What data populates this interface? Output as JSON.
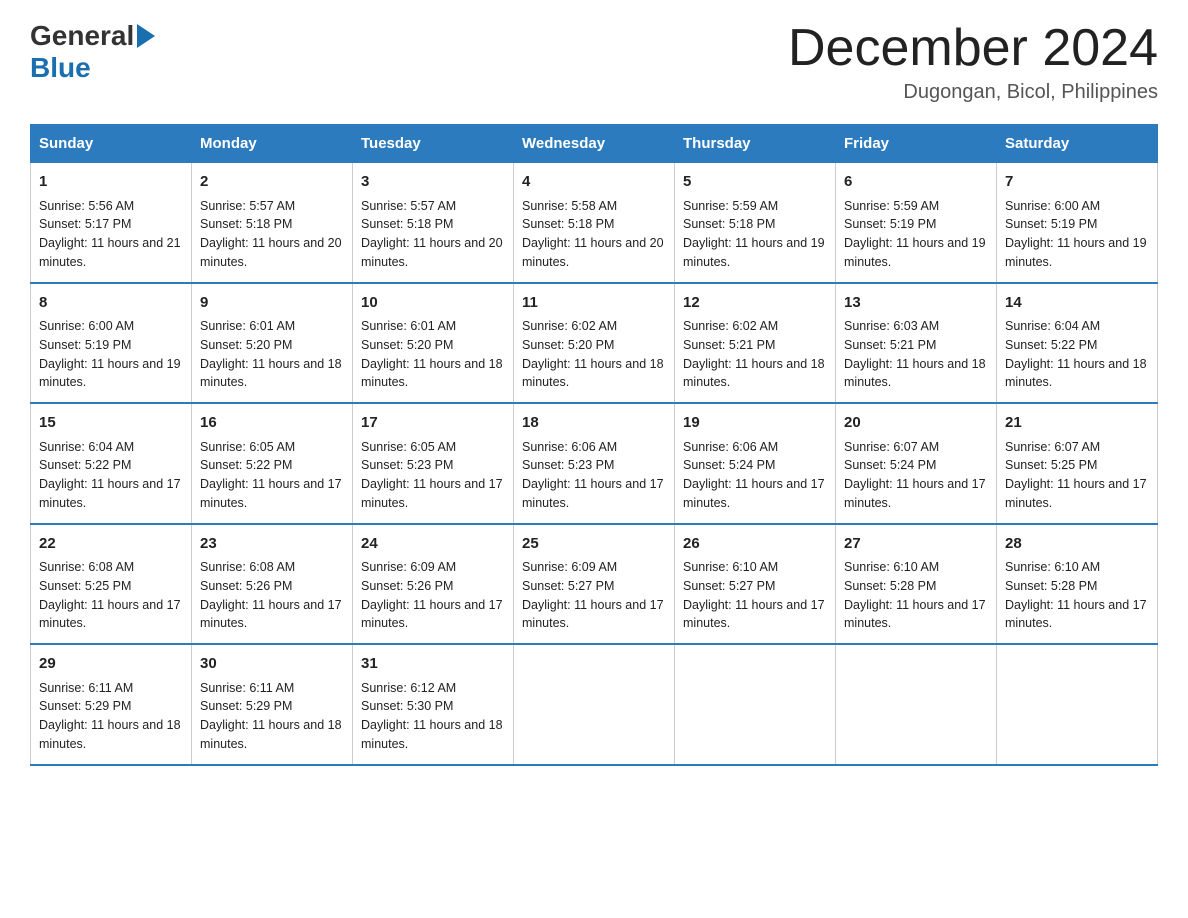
{
  "header": {
    "logo_general": "General",
    "logo_blue": "Blue",
    "month_year": "December 2024",
    "location": "Dugongan, Bicol, Philippines"
  },
  "calendar": {
    "days_of_week": [
      "Sunday",
      "Monday",
      "Tuesday",
      "Wednesday",
      "Thursday",
      "Friday",
      "Saturday"
    ],
    "weeks": [
      [
        {
          "day": 1,
          "sunrise": "5:56 AM",
          "sunset": "5:17 PM",
          "daylight": "11 hours and 21 minutes."
        },
        {
          "day": 2,
          "sunrise": "5:57 AM",
          "sunset": "5:18 PM",
          "daylight": "11 hours and 20 minutes."
        },
        {
          "day": 3,
          "sunrise": "5:57 AM",
          "sunset": "5:18 PM",
          "daylight": "11 hours and 20 minutes."
        },
        {
          "day": 4,
          "sunrise": "5:58 AM",
          "sunset": "5:18 PM",
          "daylight": "11 hours and 20 minutes."
        },
        {
          "day": 5,
          "sunrise": "5:59 AM",
          "sunset": "5:18 PM",
          "daylight": "11 hours and 19 minutes."
        },
        {
          "day": 6,
          "sunrise": "5:59 AM",
          "sunset": "5:19 PM",
          "daylight": "11 hours and 19 minutes."
        },
        {
          "day": 7,
          "sunrise": "6:00 AM",
          "sunset": "5:19 PM",
          "daylight": "11 hours and 19 minutes."
        }
      ],
      [
        {
          "day": 8,
          "sunrise": "6:00 AM",
          "sunset": "5:19 PM",
          "daylight": "11 hours and 19 minutes."
        },
        {
          "day": 9,
          "sunrise": "6:01 AM",
          "sunset": "5:20 PM",
          "daylight": "11 hours and 18 minutes."
        },
        {
          "day": 10,
          "sunrise": "6:01 AM",
          "sunset": "5:20 PM",
          "daylight": "11 hours and 18 minutes."
        },
        {
          "day": 11,
          "sunrise": "6:02 AM",
          "sunset": "5:20 PM",
          "daylight": "11 hours and 18 minutes."
        },
        {
          "day": 12,
          "sunrise": "6:02 AM",
          "sunset": "5:21 PM",
          "daylight": "11 hours and 18 minutes."
        },
        {
          "day": 13,
          "sunrise": "6:03 AM",
          "sunset": "5:21 PM",
          "daylight": "11 hours and 18 minutes."
        },
        {
          "day": 14,
          "sunrise": "6:04 AM",
          "sunset": "5:22 PM",
          "daylight": "11 hours and 18 minutes."
        }
      ],
      [
        {
          "day": 15,
          "sunrise": "6:04 AM",
          "sunset": "5:22 PM",
          "daylight": "11 hours and 17 minutes."
        },
        {
          "day": 16,
          "sunrise": "6:05 AM",
          "sunset": "5:22 PM",
          "daylight": "11 hours and 17 minutes."
        },
        {
          "day": 17,
          "sunrise": "6:05 AM",
          "sunset": "5:23 PM",
          "daylight": "11 hours and 17 minutes."
        },
        {
          "day": 18,
          "sunrise": "6:06 AM",
          "sunset": "5:23 PM",
          "daylight": "11 hours and 17 minutes."
        },
        {
          "day": 19,
          "sunrise": "6:06 AM",
          "sunset": "5:24 PM",
          "daylight": "11 hours and 17 minutes."
        },
        {
          "day": 20,
          "sunrise": "6:07 AM",
          "sunset": "5:24 PM",
          "daylight": "11 hours and 17 minutes."
        },
        {
          "day": 21,
          "sunrise": "6:07 AM",
          "sunset": "5:25 PM",
          "daylight": "11 hours and 17 minutes."
        }
      ],
      [
        {
          "day": 22,
          "sunrise": "6:08 AM",
          "sunset": "5:25 PM",
          "daylight": "11 hours and 17 minutes."
        },
        {
          "day": 23,
          "sunrise": "6:08 AM",
          "sunset": "5:26 PM",
          "daylight": "11 hours and 17 minutes."
        },
        {
          "day": 24,
          "sunrise": "6:09 AM",
          "sunset": "5:26 PM",
          "daylight": "11 hours and 17 minutes."
        },
        {
          "day": 25,
          "sunrise": "6:09 AM",
          "sunset": "5:27 PM",
          "daylight": "11 hours and 17 minutes."
        },
        {
          "day": 26,
          "sunrise": "6:10 AM",
          "sunset": "5:27 PM",
          "daylight": "11 hours and 17 minutes."
        },
        {
          "day": 27,
          "sunrise": "6:10 AM",
          "sunset": "5:28 PM",
          "daylight": "11 hours and 17 minutes."
        },
        {
          "day": 28,
          "sunrise": "6:10 AM",
          "sunset": "5:28 PM",
          "daylight": "11 hours and 17 minutes."
        }
      ],
      [
        {
          "day": 29,
          "sunrise": "6:11 AM",
          "sunset": "5:29 PM",
          "daylight": "11 hours and 18 minutes."
        },
        {
          "day": 30,
          "sunrise": "6:11 AM",
          "sunset": "5:29 PM",
          "daylight": "11 hours and 18 minutes."
        },
        {
          "day": 31,
          "sunrise": "6:12 AM",
          "sunset": "5:30 PM",
          "daylight": "11 hours and 18 minutes."
        },
        null,
        null,
        null,
        null
      ]
    ]
  }
}
